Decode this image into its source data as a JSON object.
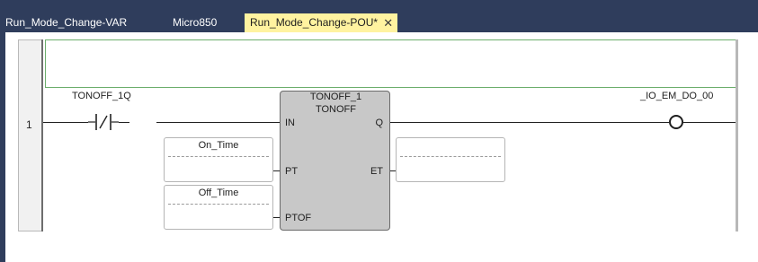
{
  "tabs": [
    {
      "label": "Run_Mode_Change-VAR",
      "active": false
    },
    {
      "label": "Micro850",
      "active": false
    },
    {
      "label": "Run_Mode_Change-POU*",
      "active": true,
      "close_glyph": "✕"
    }
  ],
  "rung": {
    "number": "1",
    "contact": {
      "variable": "TONOFF_1Q",
      "type": "normally-closed"
    },
    "block": {
      "instance": "TONOFF_1",
      "type": "TONOFF",
      "inputs": [
        "IN",
        "PT",
        "PTOF"
      ],
      "outputs": [
        "Q",
        "ET"
      ]
    },
    "pt_variable": "On_Time",
    "ptof_variable": "Off_Time",
    "et_variable": "",
    "coil": {
      "variable": "_IO_EM_DO_00"
    }
  },
  "colors": {
    "tabbar_bg": "#2f3d5c",
    "active_tab_bg": "#fff3a0",
    "comment_border": "#6cae6c",
    "block_fill": "#c8c8c8"
  },
  "icons": {
    "tab_close": "close-icon",
    "contact": "normally-closed-contact-icon",
    "coil": "coil-icon"
  }
}
